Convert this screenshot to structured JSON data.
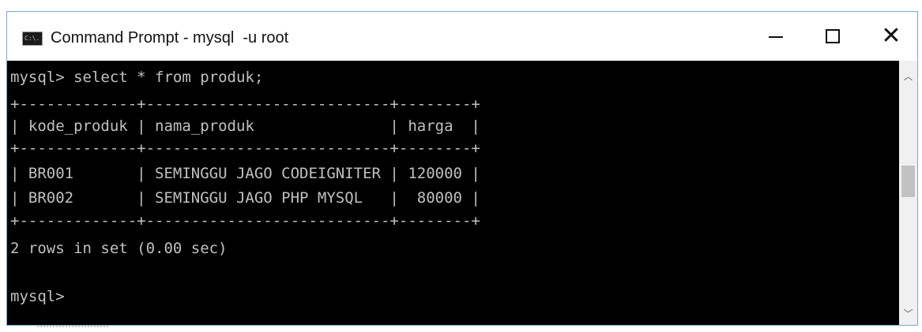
{
  "window": {
    "title": "Command Prompt - mysql  -u root",
    "icon": "cmd-icon",
    "icon_text": "C:\\.",
    "controls": {
      "minimize": "minimize-icon",
      "maximize": "maximize-icon",
      "close": "close-icon"
    }
  },
  "console": {
    "lines": [
      "mysql> select * from produk;",
      "+-------------+---------------------------+--------+",
      "| kode_produk | nama_produk               | harga  |",
      "+-------------+---------------------------+--------+",
      "| BR001       | SEMINGGU JAGO CODEIGNITER | 120000 |",
      "| BR002       | SEMINGGU JAGO PHP MYSQL   |  80000 |",
      "+-------------+---------------------------+--------+",
      "2 rows in set (0.00 sec)",
      "",
      "mysql>"
    ],
    "table": {
      "columns": [
        "kode_produk",
        "nama_produk",
        "harga"
      ],
      "rows": [
        [
          "BR001",
          "SEMINGGU JAGO CODEIGNITER",
          "120000"
        ],
        [
          "BR002",
          "SEMINGGU JAGO PHP MYSQL",
          "80000"
        ]
      ]
    },
    "colors": {
      "background": "#000000",
      "text": "#c0c0c0"
    }
  },
  "scrollbar": {
    "up_icon": "chevron-up-icon",
    "down_icon": "chevron-down-icon"
  }
}
